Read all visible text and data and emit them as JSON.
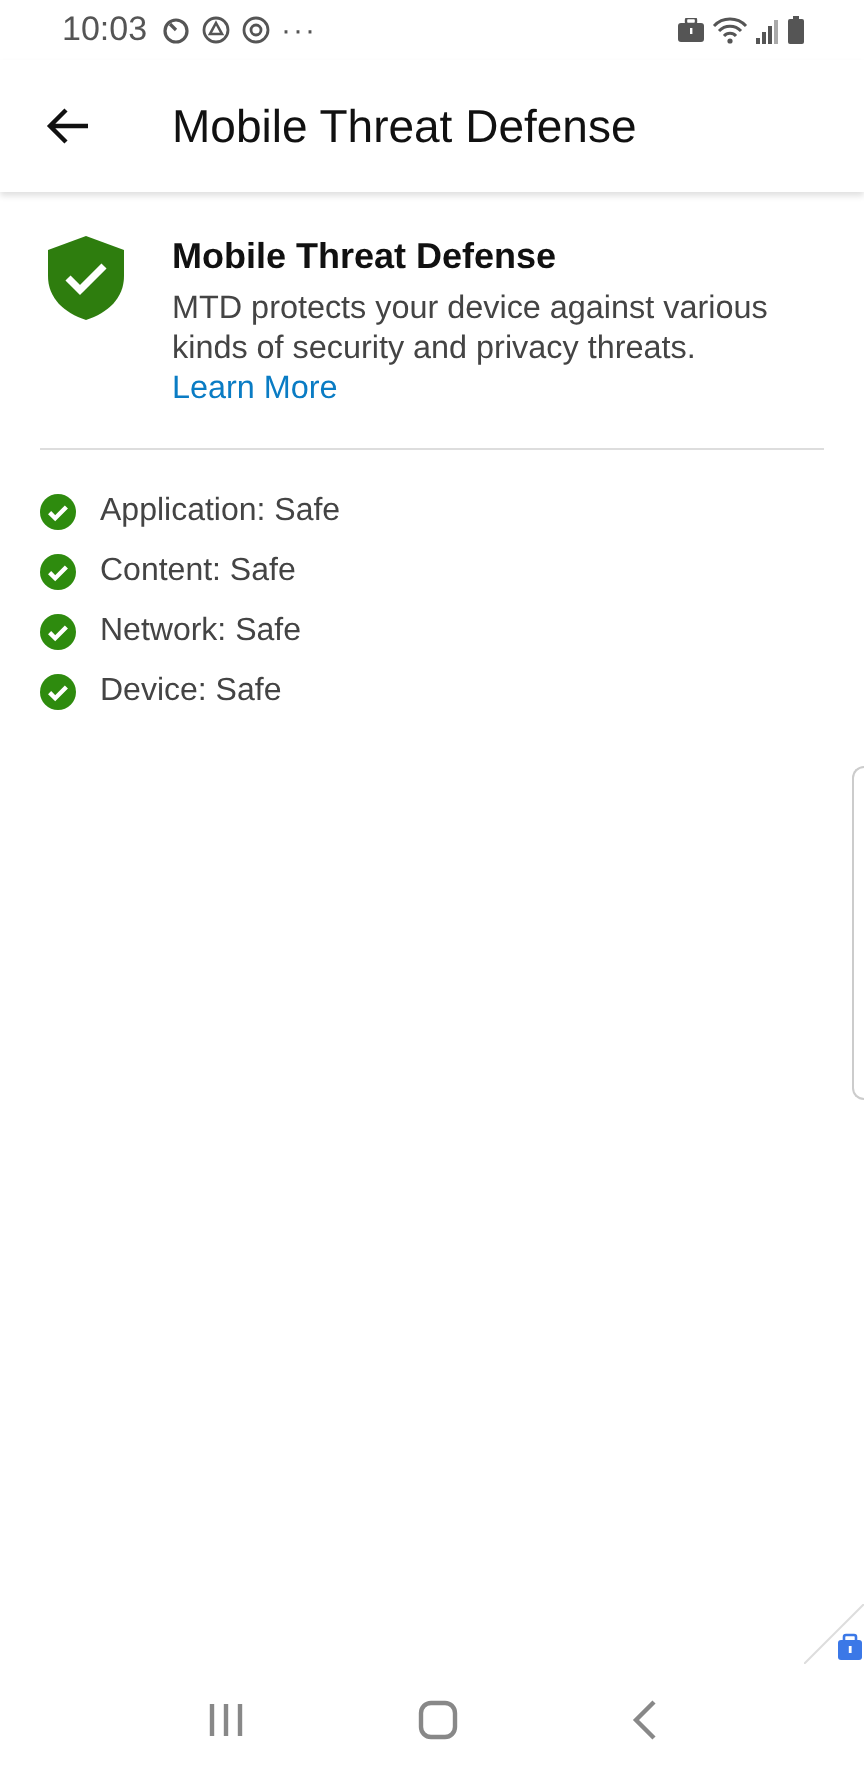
{
  "status_bar": {
    "time": "10:03",
    "more": "···"
  },
  "app_bar": {
    "title": "Mobile Threat Defense"
  },
  "summary": {
    "title": "Mobile Threat Defense",
    "description": "MTD protects your device against various kinds of security and privacy threats.",
    "link": "Learn More"
  },
  "checks": [
    {
      "text": "Application: Safe"
    },
    {
      "text": "Content: Safe"
    },
    {
      "text": "Network: Safe"
    },
    {
      "text": "Device: Safe"
    }
  ]
}
